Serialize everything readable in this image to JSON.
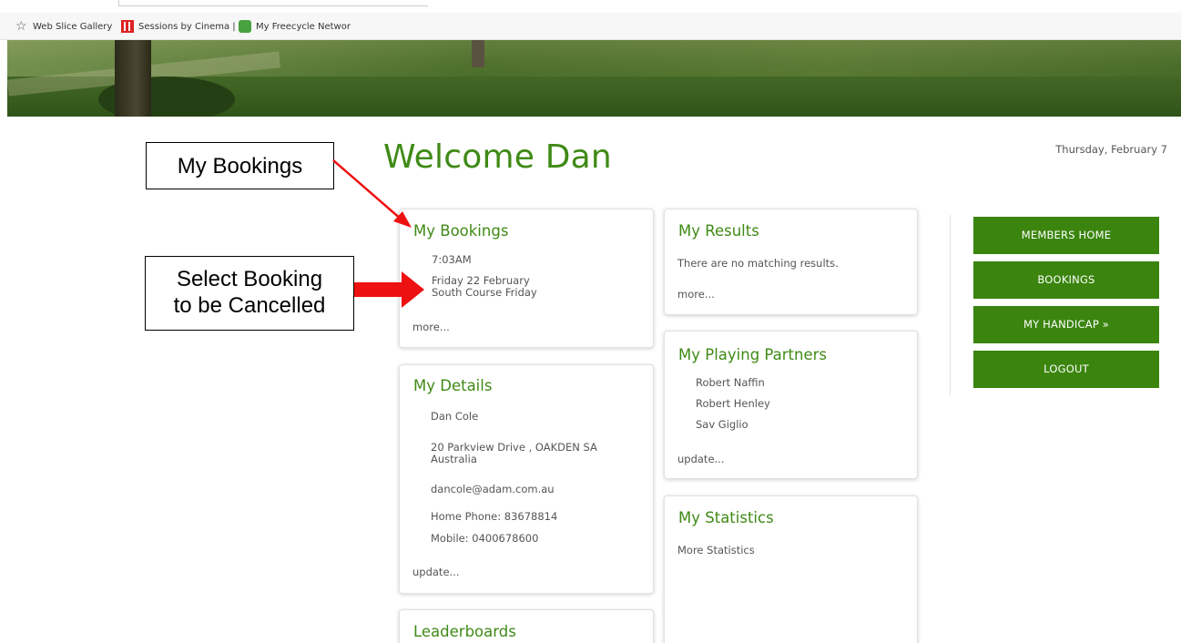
{
  "bookmarks": [
    {
      "label": "Web Slice Gallery",
      "icon": "star-icon"
    },
    {
      "label": "Sessions by Cinema |",
      "icon": "cinema-icon"
    },
    {
      "label": "My Freecycle Networ",
      "icon": "freecycle-icon"
    }
  ],
  "annotations": {
    "my_bookings": "My Bookings",
    "select_line1": "Select Booking",
    "select_line2": "to be Cancelled",
    "arrow_color": "#ee1111"
  },
  "page": {
    "welcome": "Welcome Dan",
    "date": "Thursday, February 7"
  },
  "bookings": {
    "title": "My Bookings",
    "time": "7:03AM",
    "date": "Friday 22 February",
    "course": "South Course Friday",
    "more": "more..."
  },
  "details": {
    "title": "My Details",
    "name": "Dan Cole",
    "address_line1": "20 Parkview Drive , OAKDEN SA",
    "address_line2": "Australia",
    "email": "dancole@adam.com.au",
    "home_phone": "Home Phone: 83678814",
    "mobile": "Mobile: 0400678600",
    "update": "update..."
  },
  "leaderboards": {
    "title": "Leaderboards"
  },
  "results": {
    "title": "My Results",
    "message": "There are no matching results.",
    "more": "more..."
  },
  "partners": {
    "title": "My Playing Partners",
    "names": [
      "Robert Naffin",
      "Robert Henley",
      "Sav Giglio"
    ],
    "update": "update..."
  },
  "statistics": {
    "title": "My Statistics",
    "link": "More Statistics"
  },
  "nav": {
    "members_home": "MEMBERS HOME",
    "bookings": "BOOKINGS",
    "my_handicap": "MY HANDICAP »",
    "logout": "LOGOUT"
  },
  "colors": {
    "accent": "#3f8a16",
    "button": "#3b850f"
  }
}
